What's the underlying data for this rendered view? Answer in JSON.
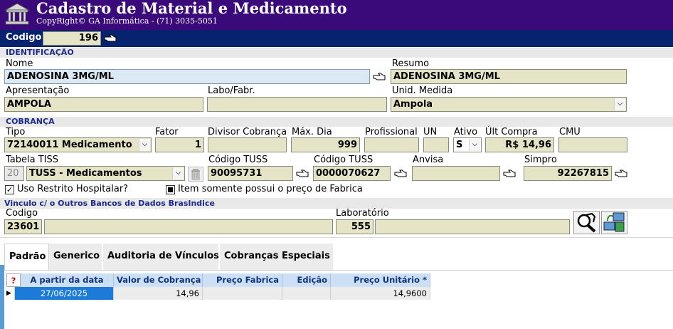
{
  "app": {
    "title": "Cadastro de Material e Medicamento",
    "copyright": "CopyRight© GA Informática - (71) 3035-5051"
  },
  "code": {
    "label": "Codigo",
    "value": "196"
  },
  "identificacao": {
    "section": "IDENTIFICAÇÃO",
    "nome_label": "Nome",
    "nome_value": "ADENOSINA 3MG/ML",
    "resumo_label": "Resumo",
    "resumo_value": "ADENOSINA 3MG/ML",
    "apresentacao_label": "Apresentação",
    "apresentacao_value": "AMPOLA",
    "labo_label": "Labo/Fabr.",
    "labo_value": "",
    "unid_label": "Unid. Medida",
    "unid_value": "Ampola"
  },
  "cobranca": {
    "section": "COBRANÇA",
    "tipo_label": "Tipo",
    "tipo_value": "72140011 Medicamento",
    "fator_label": "Fator",
    "fator_value": "1",
    "divisor_label": "Divisor Cobrança",
    "divisor_value": "",
    "maxdia_label": "Máx. Dia",
    "maxdia_value": "999",
    "profissional_label": "Profissional",
    "profissional_value": "",
    "un_label": "UN",
    "un_value": "",
    "ativo_label": "Ativo",
    "ativo_value": "S",
    "ultcompra_label": "Últ Compra",
    "ultcompra_value": "R$ 14,96",
    "cmu_label": "CMU",
    "cmu_value": "",
    "tabela_label": "Tabela TISS",
    "tabela_code": "20",
    "tabela_value": "TUSS - Medicamentos",
    "codtuss1_label": "Código TUSS",
    "codtuss1_value": "90095731",
    "codtuss2_label": "Código TUSS",
    "codtuss2_value": "0000070627",
    "anvisa_label": "Anvisa",
    "anvisa_value": "",
    "simpro_label": "Simpro",
    "simpro_value": "92267815",
    "restrito_label": "Uso Restrito Hospitalar?",
    "fabrica_label": "Item somente possui o preço de Fabrica"
  },
  "vinculo": {
    "section": "Vinculo c/ o Outros Bancos de Dados BrasIndice",
    "codigo_label": "Codigo",
    "codigo_value": "23601",
    "codigo_desc": "",
    "lab_label": "Laboratório",
    "lab_value": "555",
    "lab_desc": ""
  },
  "tabs": [
    "Padrão",
    "Generico",
    "Auditoria de Vínculos",
    "Cobranças Especiais"
  ],
  "grid": {
    "help": "?",
    "headers": [
      "A partir da data",
      "Valor de Cobrança",
      "Preço Fabrica",
      "Edição",
      "Preço Unitário *"
    ],
    "row": [
      "27/06/2025",
      "14,96",
      "",
      "",
      "14,9600"
    ]
  },
  "colors": {
    "header": "#3a0a7a",
    "codebar": "#07226f",
    "field": "#e6e4c7",
    "section_text": "#1c2a8c"
  }
}
